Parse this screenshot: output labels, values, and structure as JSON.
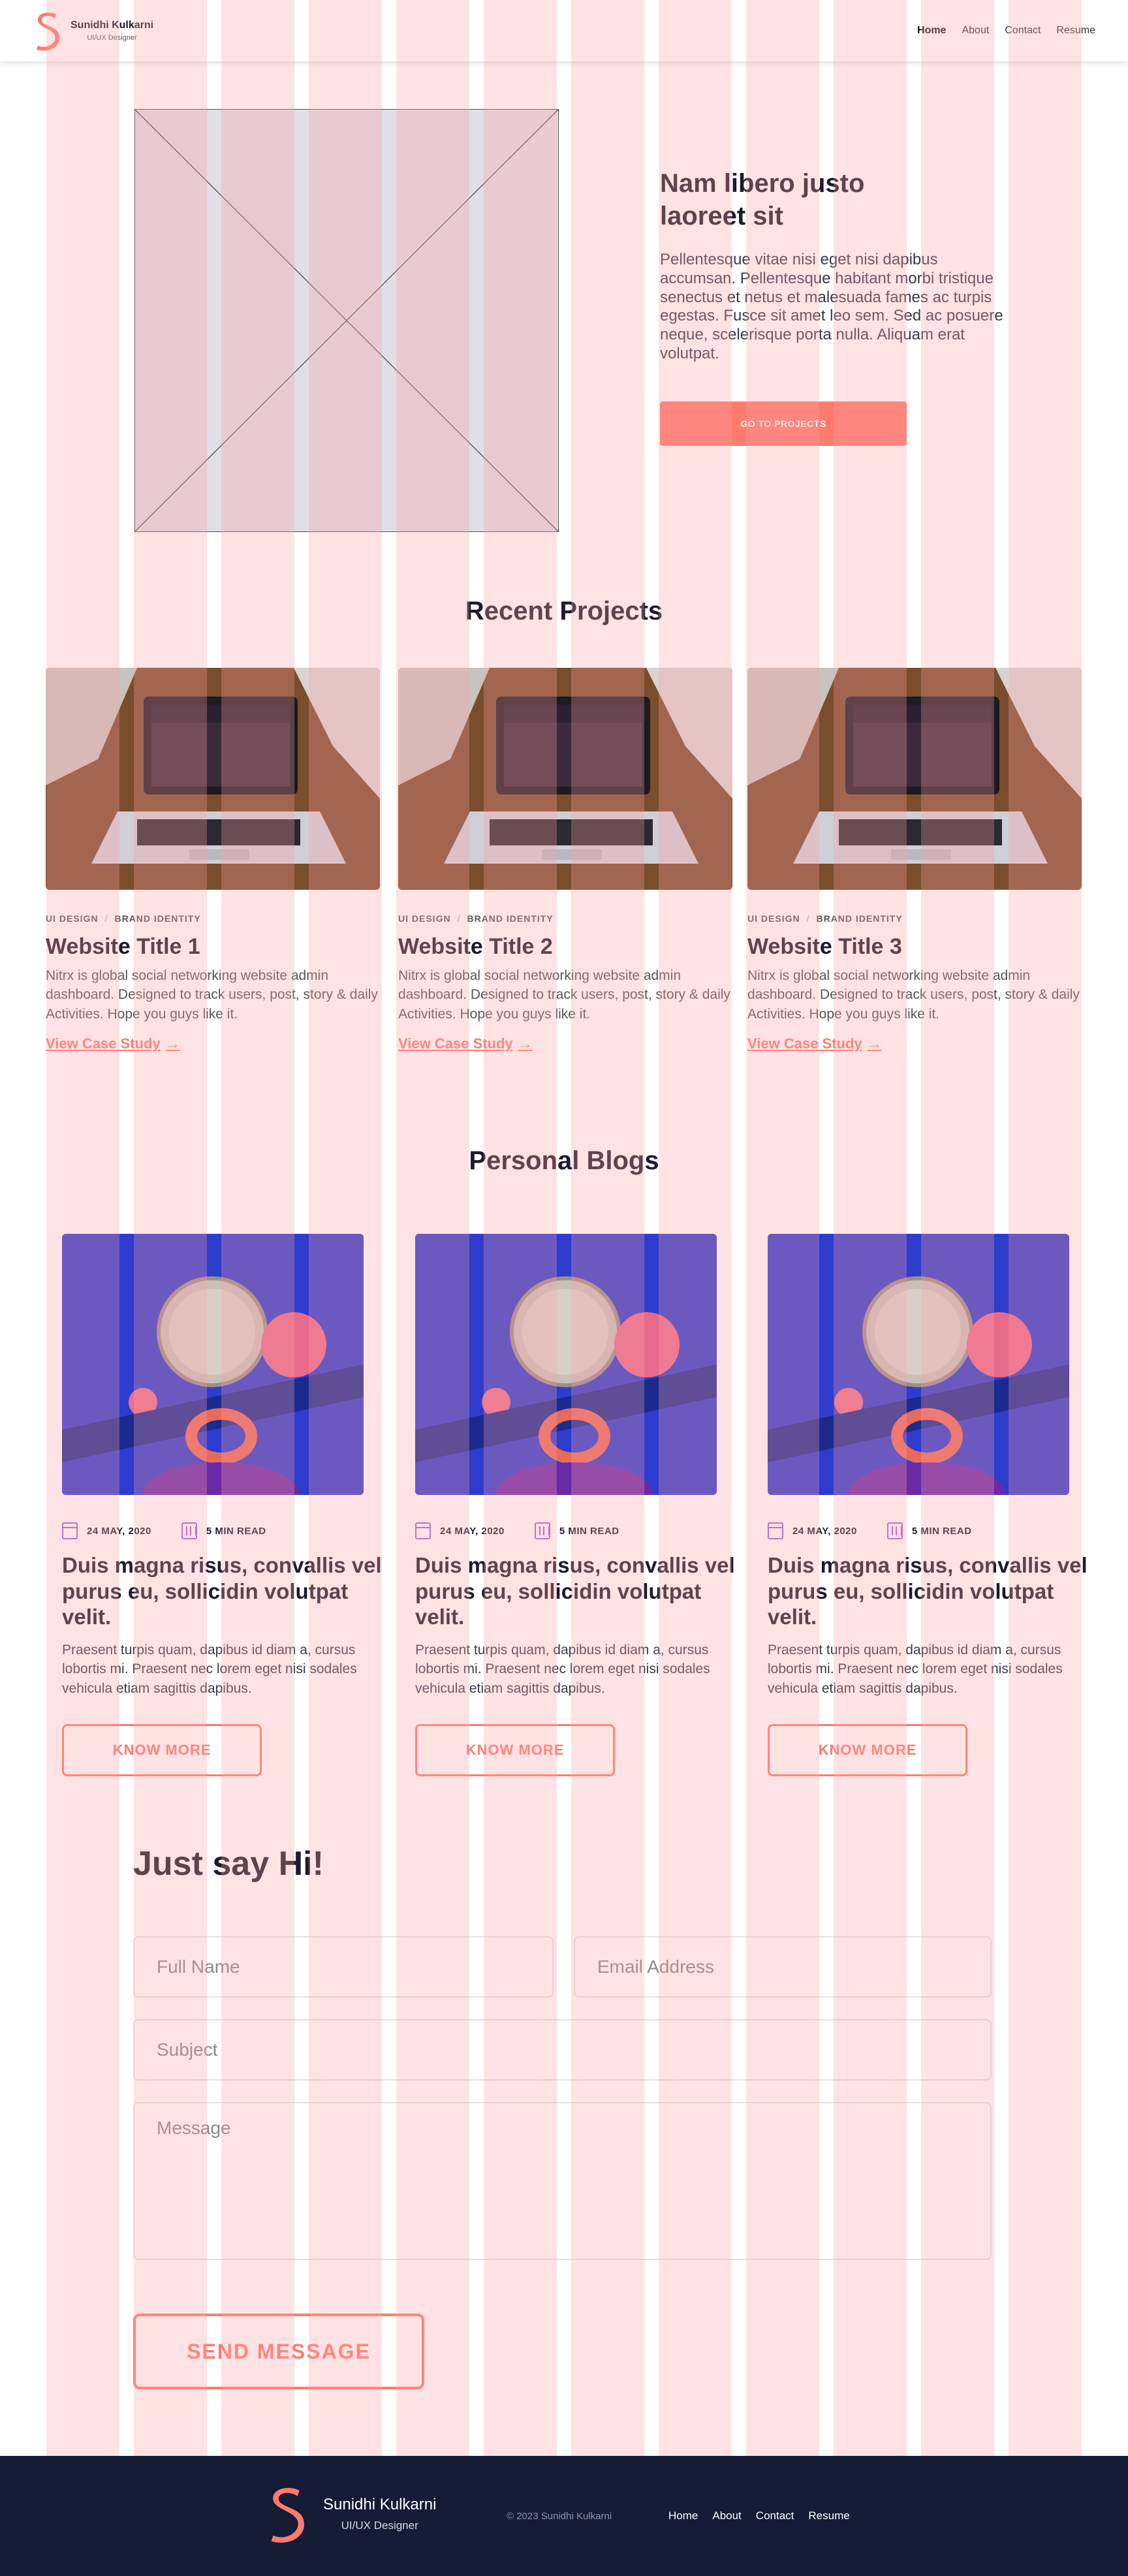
{
  "colors": {
    "accent": "#ff7b6e",
    "footer_bg": "#141c36",
    "heading": "#1c1b2a",
    "meta_icon": "#a65fd4",
    "grid_overlay": "#ffa0a5"
  },
  "nav": {
    "brand_name": "Sunidhi Kulkarni",
    "brand_role": "UI/UX Designer",
    "logo_icon": "s-logo-icon",
    "links": [
      "Home",
      "About",
      "Contact",
      "Resume"
    ],
    "active": "Home"
  },
  "hero": {
    "image_placeholder_icon": "image-placeholder-icon",
    "title": "Nam libero justo laoreet sit",
    "description": "Pellentesque vitae nisi eget nisi dapibus accumsan. Pellentesque habitant morbi tristique senectus et netus et malesuada fames ac turpis egestas. Fusce sit amet leo sem. Sed ac posuere neque, scelerisque porta nulla. Aliquam erat volutpat.",
    "button_label": "GO TO PROJECTS"
  },
  "projects": {
    "heading": "Recent Projects",
    "items": [
      {
        "tag1": "UI DESIGN",
        "tag2": "BRAND IDENTITY",
        "title": "Website Title 1",
        "description": "Nitrx is global social networking website admin dashboard. Designed to track users, post, story & daily Activities. Hope you guys like it.",
        "link_label": "View Case Study"
      },
      {
        "tag1": "UI DESIGN",
        "tag2": "BRAND IDENTITY",
        "title": "Website Title 2",
        "description": "Nitrx is global social networking website admin dashboard. Designed to track users, post, story & daily Activities. Hope you guys like it.",
        "link_label": "View Case Study"
      },
      {
        "tag1": "UI DESIGN",
        "tag2": "BRAND IDENTITY",
        "title": "Website Title 3",
        "description": "Nitrx is global social networking website admin dashboard. Designed to track users, post, story & daily Activities. Hope you guys like it.",
        "link_label": "View Case Study"
      }
    ]
  },
  "blogs": {
    "heading": "Personal Blogs",
    "items": [
      {
        "date": "24 MAY, 2020",
        "read_time": "5 MIN READ",
        "title": "Duis magna risus, convallis vel purus eu, sollicidin volutpat velit.",
        "description": "Praesent turpis quam, dapibus id diam a, cursus lobortis mi. Praesent nec lorem eget nisi sodales vehicula etiam sagittis dapibus.",
        "button_label": "KNOW MORE"
      },
      {
        "date": "24 MAY, 2020",
        "read_time": "5 MIN READ",
        "title": "Duis magna risus, convallis vel purus eu, sollicidin volutpat velit.",
        "description": "Praesent turpis quam, dapibus id diam a, cursus lobortis mi. Praesent nec lorem eget nisi sodales vehicula etiam sagittis dapibus.",
        "button_label": "KNOW MORE"
      },
      {
        "date": "24 MAY, 2020",
        "read_time": "5 MIN READ",
        "title": "Duis magna risus, convallis vel purus eu, sollicidin volutpat velit.",
        "description": "Praesent turpis quam, dapibus id diam a, cursus lobortis mi. Praesent nec lorem eget nisi sodales vehicula etiam sagittis dapibus.",
        "button_label": "KNOW MORE"
      }
    ]
  },
  "contact": {
    "heading": "Just say Hi!",
    "full_name_placeholder": "Full Name",
    "email_placeholder": "Email Address",
    "subject_placeholder": "Subject",
    "message_placeholder": "Message",
    "send_label": "SEND MESSAGE"
  },
  "footer": {
    "brand_name": "Sunidhi Kulkarni",
    "brand_role": "UI/UX Designer",
    "copyright": "© 2023 Sunidhi Kulkarni",
    "links": [
      "Home",
      "About",
      "Contact",
      "Resume"
    ]
  }
}
